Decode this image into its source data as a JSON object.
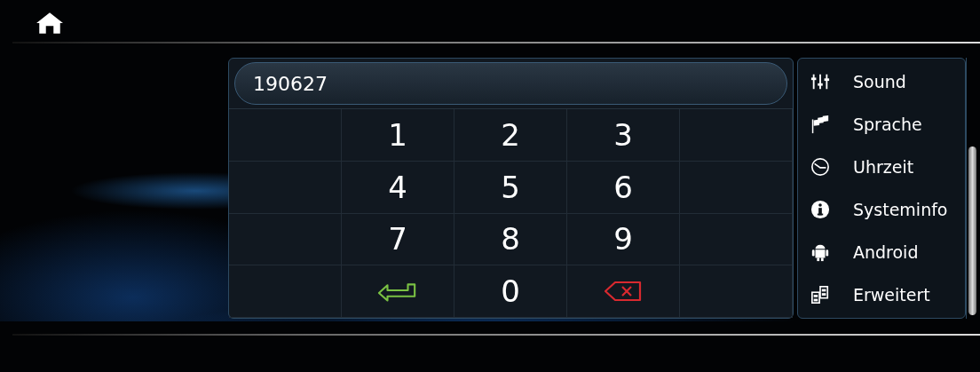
{
  "pin_entry": {
    "value": "190627"
  },
  "keypad": [
    {
      "kind": "blank"
    },
    {
      "kind": "digit",
      "label": "1"
    },
    {
      "kind": "digit",
      "label": "2"
    },
    {
      "kind": "digit",
      "label": "3"
    },
    {
      "kind": "blank"
    },
    {
      "kind": "blank"
    },
    {
      "kind": "digit",
      "label": "4"
    },
    {
      "kind": "digit",
      "label": "5"
    },
    {
      "kind": "digit",
      "label": "6"
    },
    {
      "kind": "blank"
    },
    {
      "kind": "blank"
    },
    {
      "kind": "digit",
      "label": "7"
    },
    {
      "kind": "digit",
      "label": "8"
    },
    {
      "kind": "digit",
      "label": "9"
    },
    {
      "kind": "blank"
    },
    {
      "kind": "blank"
    },
    {
      "kind": "enter"
    },
    {
      "kind": "digit",
      "label": "0"
    },
    {
      "kind": "delete"
    },
    {
      "kind": "blank"
    }
  ],
  "settings_menu": [
    {
      "kind": "sliders",
      "label": "Sound"
    },
    {
      "kind": "flags",
      "label": "Sprache"
    },
    {
      "kind": "clock",
      "label": "Uhrzeit"
    },
    {
      "kind": "info",
      "label": "Systeminfo"
    },
    {
      "kind": "robot",
      "label": "Android"
    },
    {
      "kind": "blocks",
      "label": "Erweitert"
    }
  ]
}
